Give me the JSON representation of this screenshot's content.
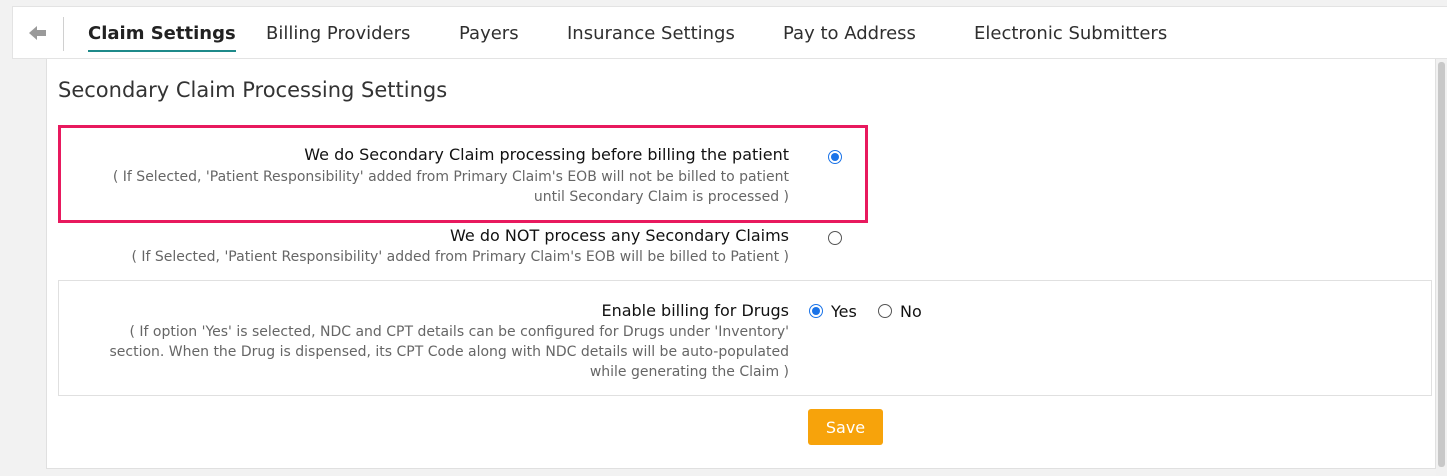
{
  "tabs": [
    {
      "label": "Claim Settings",
      "active": true
    },
    {
      "label": "Billing Providers"
    },
    {
      "label": "Payers"
    },
    {
      "label": "Insurance Settings"
    },
    {
      "label": "Pay to Address"
    },
    {
      "label": "Electronic Submitters"
    }
  ],
  "section": {
    "title": "Secondary Claim Processing Settings"
  },
  "options": [
    {
      "label": "We do Secondary Claim processing before billing the patient",
      "note_line1": "( If Selected, 'Patient Responsibility' added from Primary Claim's EOB will not be billed to patient",
      "note_line2": "until Secondary Claim is processed )",
      "selected": true
    },
    {
      "label": "We do NOT process any Secondary Claims",
      "note_line1": "( If Selected, 'Patient Responsibility' added from Primary Claim's EOB will be billed to Patient )",
      "selected": false
    }
  ],
  "drugs": {
    "label": "Enable billing for Drugs",
    "note_line1": "( If option 'Yes' is selected, NDC and CPT details can be configured for Drugs under 'Inventory'",
    "note_line2": "section. When the Drug is dispensed, its CPT Code along with NDC details will be auto-populated",
    "note_line3": "while generating the Claim )",
    "yes_label": "Yes",
    "no_label": "No",
    "selected": "Yes"
  },
  "save_label": "Save",
  "colors": {
    "accent_underline": "#1e8a8a",
    "highlight_border": "#e8195e",
    "radio_selected": "#1a73e8",
    "save_button": "#f7a30b"
  },
  "icons": {
    "back": "arrow-left-icon"
  }
}
